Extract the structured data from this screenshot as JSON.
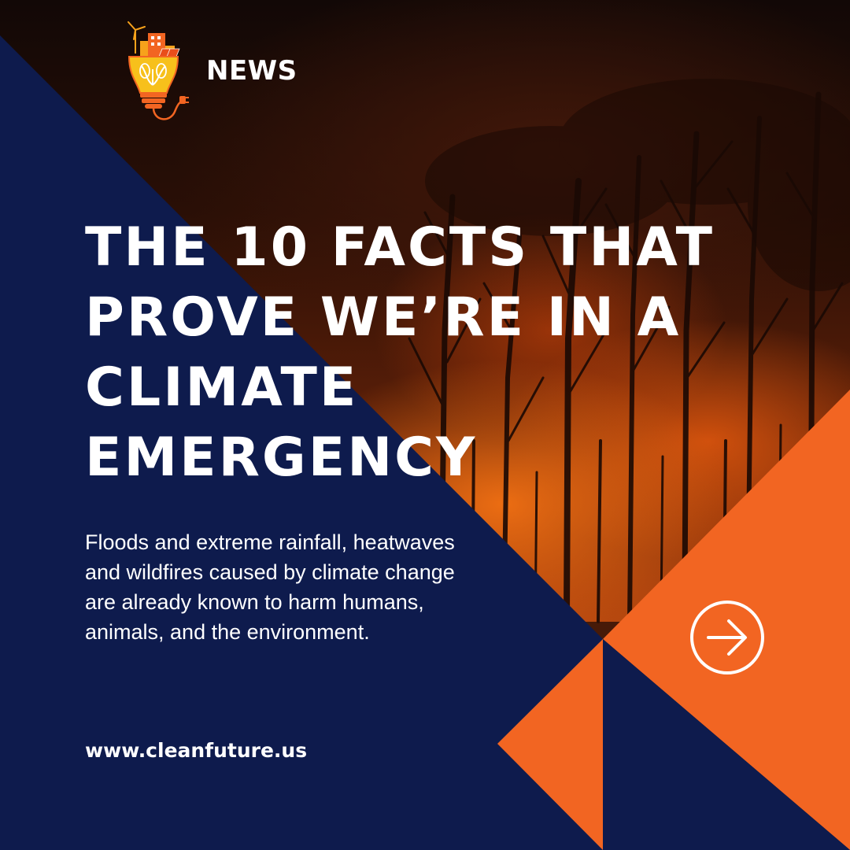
{
  "brand": {
    "news_label": "NEWS",
    "logo_icon": "lightbulb-city-plug-logo"
  },
  "headline": {
    "lines": [
      "THE 10 FACTS THAT",
      "PROVE WE’RE IN A",
      "CLIMATE",
      "EMERGENCY"
    ]
  },
  "body": {
    "text": "Floods and extreme rainfall, heatwaves and wildfires caused by climate change are already known to harm humans, animals, and the environment."
  },
  "footer": {
    "website": "www.cleanfuture.us"
  },
  "next_button": {
    "icon": "arrow-right-circle-icon"
  },
  "colors": {
    "navy": "#0e1b4d",
    "orange": "#f26522",
    "white": "#ffffff"
  }
}
